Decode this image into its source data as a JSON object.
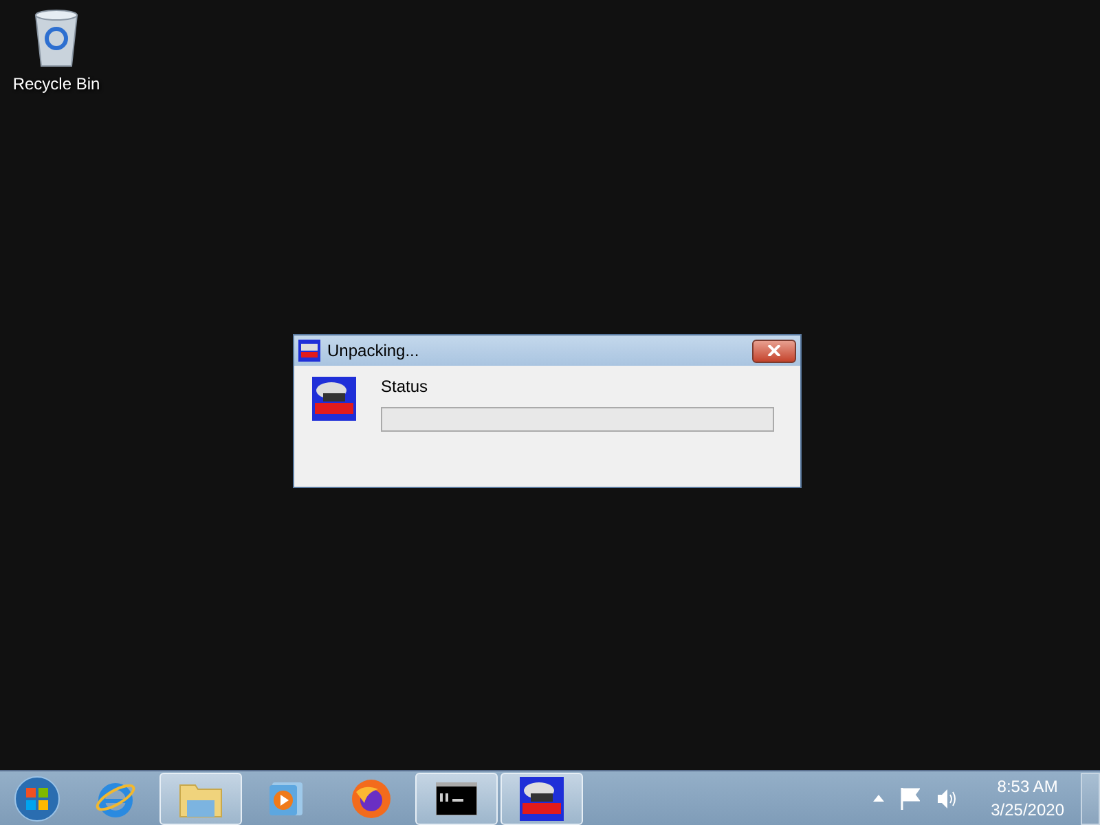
{
  "desktop": {
    "icons": [
      {
        "label": "Recycle Bin",
        "kind": "recycle"
      }
    ]
  },
  "dialog": {
    "title": "Unpacking...",
    "status_label": "Status",
    "progress": {
      "level": 0
    }
  },
  "taskbar": {
    "items": [
      {
        "kind": "ie",
        "open": false
      },
      {
        "kind": "explorer",
        "open": true
      },
      {
        "kind": "media",
        "open": false
      },
      {
        "kind": "firefox",
        "open": false
      },
      {
        "kind": "cmd",
        "open": true
      },
      {
        "kind": "app",
        "open": true
      }
    ],
    "clock": {
      "time": "8:53 AM",
      "date": "3/25/2020"
    }
  }
}
